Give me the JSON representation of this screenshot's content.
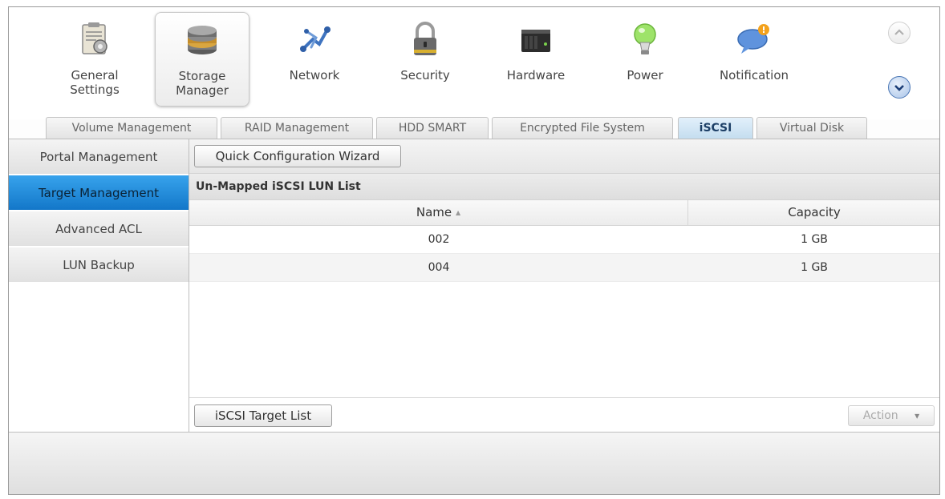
{
  "toolbar": {
    "items": [
      {
        "label": "General\nSettings",
        "icon": "clipboard-settings-icon"
      },
      {
        "label": "Storage\nManager",
        "icon": "disk-stack-icon"
      },
      {
        "label": "Network",
        "icon": "network-icon"
      },
      {
        "label": "Security",
        "icon": "padlock-icon"
      },
      {
        "label": "Hardware",
        "icon": "server-icon"
      },
      {
        "label": "Power",
        "icon": "lightbulb-icon"
      },
      {
        "label": "Notification",
        "icon": "speech-bubble-icon"
      }
    ],
    "active_index": 1,
    "scroll_up_icon": "chevron-up-icon",
    "scroll_down_icon": "chevron-down-icon"
  },
  "tabs": [
    {
      "label": "Volume Management"
    },
    {
      "label": "RAID Management"
    },
    {
      "label": "HDD SMART"
    },
    {
      "label": "Encrypted File System"
    },
    {
      "label": "iSCSI"
    },
    {
      "label": "Virtual Disk"
    }
  ],
  "active_tab": "iSCSI",
  "sidebar": {
    "items": [
      {
        "label": "Portal Management"
      },
      {
        "label": "Target Management"
      },
      {
        "label": "Advanced ACL"
      },
      {
        "label": "LUN Backup"
      }
    ],
    "active": "Target Management"
  },
  "main": {
    "wizard_button": "Quick Configuration Wizard",
    "section_title": "Un-Mapped iSCSI LUN List",
    "columns": [
      {
        "label": "Name",
        "sort_indicator": "▲"
      },
      {
        "label": "Capacity"
      }
    ],
    "rows": [
      {
        "name": "002",
        "capacity": "1 GB"
      },
      {
        "name": "004",
        "capacity": "1 GB"
      }
    ],
    "target_list_button": "iSCSI Target List",
    "action_button": "Action",
    "action_arrow": "▾"
  },
  "colors": {
    "accent_blue": "#1f8ddd",
    "tab_active_text": "#1d3f66"
  }
}
